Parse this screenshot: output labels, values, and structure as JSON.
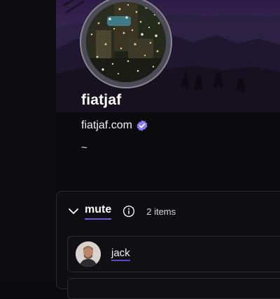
{
  "profile": {
    "display_name": "fiatjaf",
    "nip05": "fiatjaf.com",
    "about": "~"
  },
  "list": {
    "title": "mute",
    "item_count": "2 items",
    "items": [
      {
        "name": "jack"
      }
    ]
  },
  "colors": {
    "accent": "#6b5bd6",
    "verified_badge": "#8b7cf6",
    "background": "#0b0a0d"
  },
  "icons": {
    "collapse": "chevron-down-icon",
    "info": "info-icon",
    "verified": "verified-badge-icon"
  }
}
